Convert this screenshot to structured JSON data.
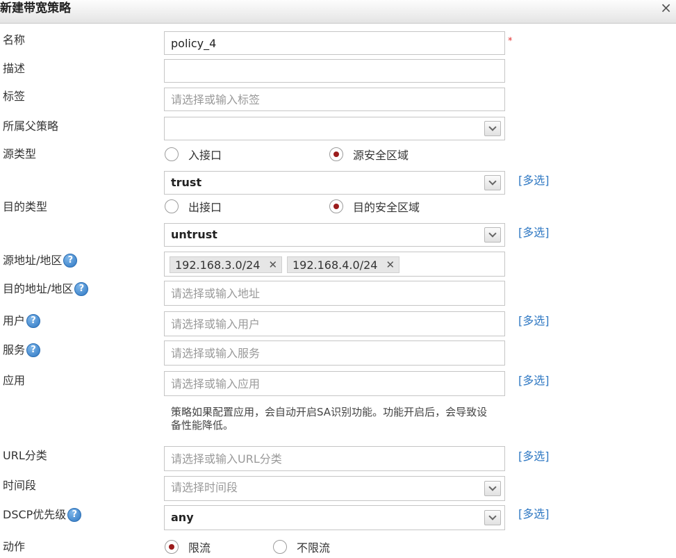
{
  "dialog": {
    "title": "新建带宽策略",
    "close_glyph": "×"
  },
  "labels": {
    "name": "名称",
    "desc": "描述",
    "tag": "标签",
    "parent": "所属父策略",
    "src_type": "源类型",
    "dst_type": "目的类型",
    "src_addr": "源地址/地区",
    "dst_addr": "目的地址/地区",
    "user": "用户",
    "service": "服务",
    "app": "应用",
    "url": "URL分类",
    "time": "时间段",
    "dscp": "DSCP优先级",
    "action": "动作"
  },
  "help_glyph": "?",
  "multi_label": "[多选]",
  "required_mark": "*",
  "fields": {
    "name_value": "policy_4",
    "desc_value": "",
    "tag_placeholder": "请选择或输入标签",
    "parent_value": "",
    "src_zone_value": "trust",
    "dst_zone_value": "untrust",
    "src_addr_tags": [
      "192.168.3.0/24",
      "192.168.4.0/24"
    ],
    "tag_remove_glyph": "✕",
    "dst_addr_placeholder": "请选择或输入地址",
    "user_placeholder": "请选择或输入用户",
    "service_placeholder": "请选择或输入服务",
    "app_placeholder": "请选择或输入应用",
    "app_note": "策略如果配置应用，会自动开启SA识别功能。功能开启后，会导致设备性能降低。",
    "url_placeholder": "请选择或输入URL分类",
    "time_placeholder": "请选择时间段",
    "dscp_value": "any"
  },
  "src_type_options": [
    {
      "label": "入接口",
      "checked": false
    },
    {
      "label": "源安全区域",
      "checked": true
    }
  ],
  "dst_type_options": [
    {
      "label": "出接口",
      "checked": false
    },
    {
      "label": "目的安全区域",
      "checked": true
    }
  ],
  "action_options": [
    {
      "label": "限流",
      "checked": true
    },
    {
      "label": "不限流",
      "checked": false
    }
  ],
  "colors": {
    "link": "#2f78c3",
    "radio_dot": "#9b1c1c",
    "required": "#e23232"
  }
}
